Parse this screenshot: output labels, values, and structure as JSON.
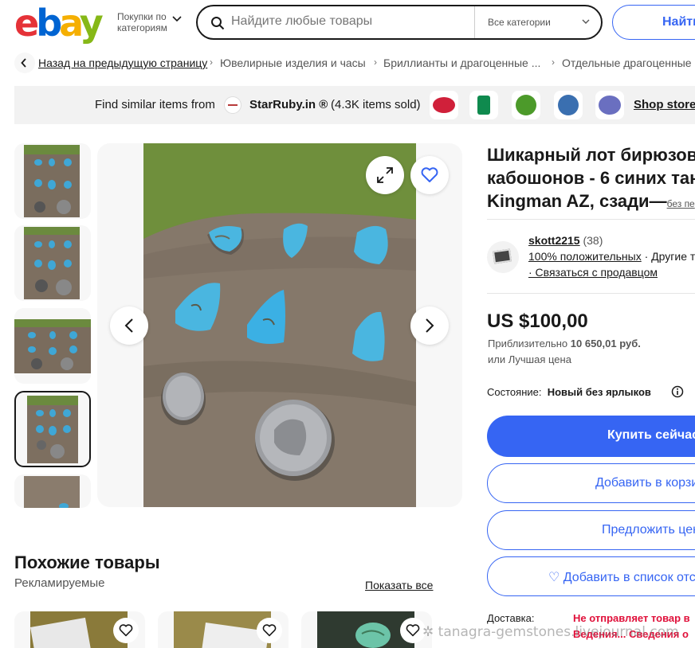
{
  "header": {
    "logo": [
      "e",
      "b",
      "a",
      "y"
    ],
    "shop_by_category": "Покупки по категориям",
    "search_placeholder": "Найдите любые товары",
    "category_select": "Все категории",
    "search_button": "Найти"
  },
  "breadcrumb": {
    "back": "Назад на предыдущую страницу",
    "items": [
      "Ювелирные изделия и часы",
      "Бриллианты и драгоценные ...",
      "Отдельные драгоценные к"
    ]
  },
  "store_banner": {
    "prefix": "Find similar items from",
    "store_name": "StarRuby.in ®",
    "sold": "(4.3K items sold)",
    "shop_link": "Shop store",
    "gem_colors": [
      "#d0203a",
      "#0f8a4e",
      "#4c9a2a",
      "#3a6fb0",
      "#6a6fc0"
    ]
  },
  "gallery": {
    "thumbnail_count": 5,
    "selected_index": 3
  },
  "item": {
    "title_lines": [
      "Шикарный лот бирюзов",
      "кабошонов - 6 синих тан",
      "Kingman AZ, сзади—"
    ],
    "title_tail": "без пе",
    "seller": {
      "name": "skott2215",
      "feedback_count": "(38)",
      "positive": "100% положительных",
      "other": "· Другие то",
      "contact": "· Связаться с продавцом"
    },
    "price": "US $100,00",
    "approx_prefix": "Приблизительно",
    "approx_value": "10 650,01 руб.",
    "best_offer": "или Лучшая цена",
    "condition_label": "Состояние:",
    "condition_value": "Новый без ярлыков",
    "buttons": {
      "buy_now": "Купить сейчас",
      "add_to_cart": "Добавить в корзи",
      "make_offer": "Предложить цен",
      "watchlist": "♡ Добавить в список отсл"
    },
    "delivery_label": "Доставка:",
    "delivery_warning": "Не отправляет товар в",
    "delivery_warning_2": "Ведения... Сведения о"
  },
  "similar": {
    "title": "Похожие товары",
    "subtitle": "Рекламируемые",
    "show_all": "Показать все"
  },
  "watermark": "✲ tanagra-gemstones.livejournal.com"
}
